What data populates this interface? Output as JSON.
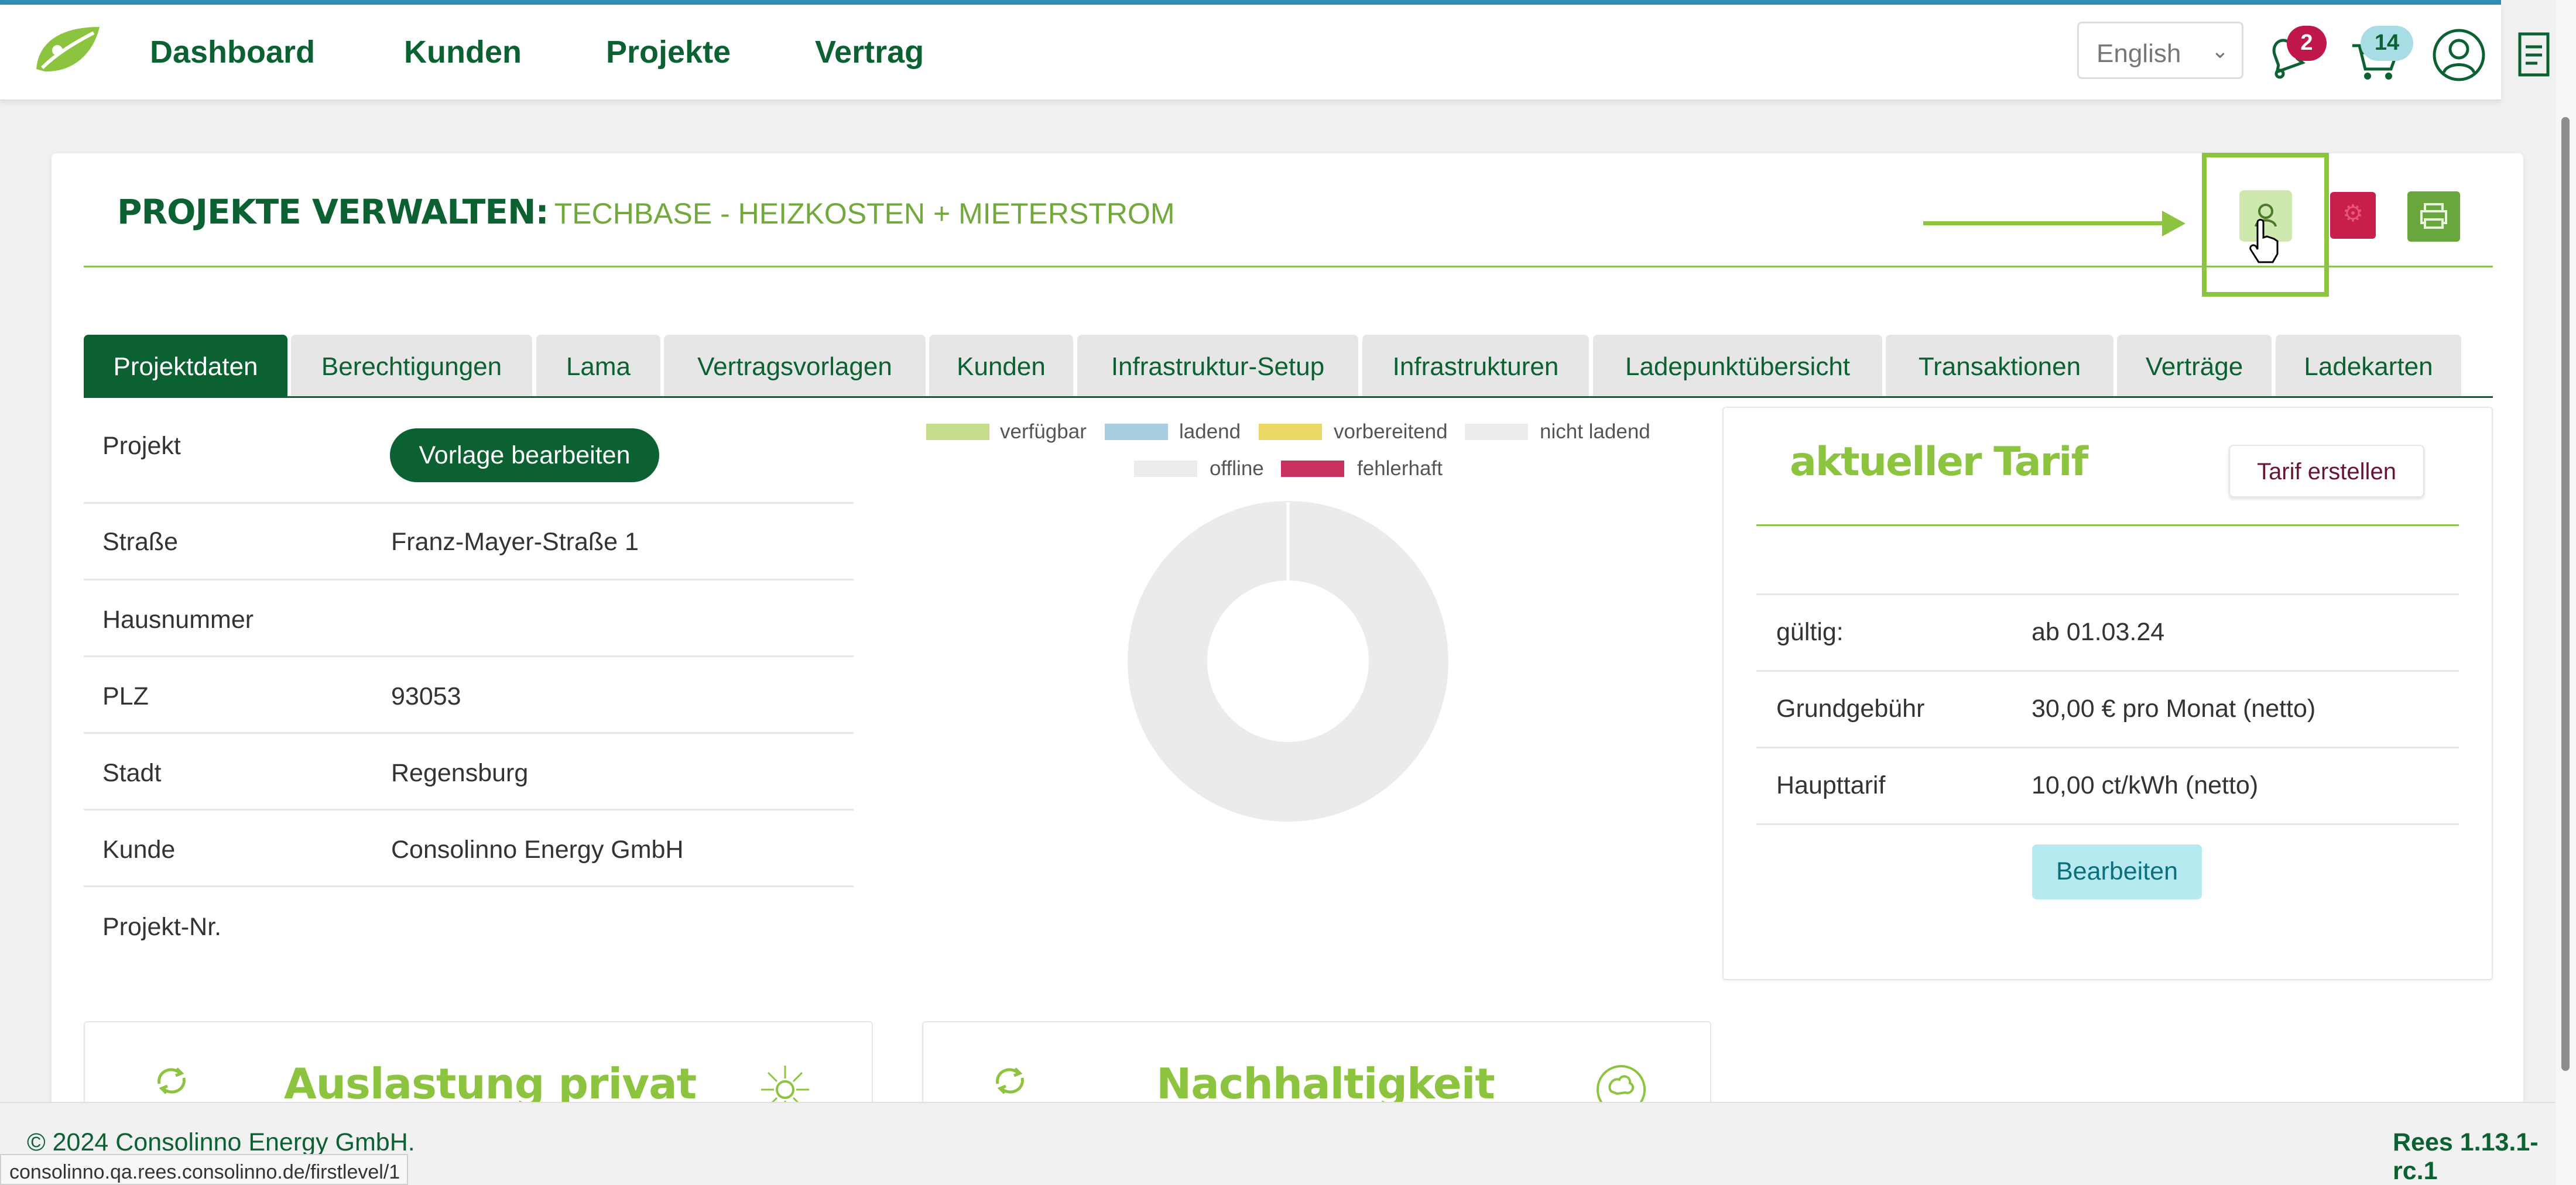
{
  "nav": {
    "links": [
      "Dashboard",
      "Kunden",
      "Projekte",
      "Vertrag"
    ],
    "language": "English",
    "notifications_count": "2",
    "messages_count": "14"
  },
  "page": {
    "title_bold": "PROJEKTE VERWALTEN:",
    "title_sub": "TECHBASE - HEIZKOSTEN + MIETERSTROM"
  },
  "tabs": [
    "Projektdaten",
    "Berechtigungen",
    "Lama",
    "Vertragsvorlagen",
    "Kunden",
    "Infrastruktur-Setup",
    "Infrastrukturen",
    "Ladepunktübersicht",
    "Transaktionen",
    "Verträge",
    "Ladekarten"
  ],
  "project": {
    "edit_template_label": "Vorlage bearbeiten",
    "rows": [
      {
        "label": "Projekt",
        "value": ""
      },
      {
        "label": "Straße",
        "value": "Franz-Mayer-Straße 1"
      },
      {
        "label": "Hausnummer",
        "value": ""
      },
      {
        "label": "PLZ",
        "value": "93053"
      },
      {
        "label": "Stadt",
        "value": "Regensburg"
      },
      {
        "label": "Kunde",
        "value": "Consolinno Energy GmbH"
      },
      {
        "label": "Projekt-Nr.",
        "value": ""
      }
    ]
  },
  "chart_data": {
    "type": "pie",
    "categories": [
      "verfügbar",
      "ladend",
      "vorbereitend",
      "nicht ladend",
      "offline",
      "fehlerhaft"
    ],
    "values": [
      0,
      0,
      0,
      0,
      0,
      0
    ],
    "colors": [
      "#c5dc8a",
      "#a9cde0",
      "#ecd865",
      "#ececec",
      "#ececec",
      "#c9325f"
    ],
    "legend": "top",
    "donut": true
  },
  "tariff": {
    "title": "aktueller Tarif",
    "create_label": "Tarif erstellen",
    "rows": [
      {
        "label": "gültig:",
        "value": "ab 01.03.24"
      },
      {
        "label": "Grundgebühr",
        "value": "30,00 € pro Monat (netto)"
      },
      {
        "label": "Haupttarif",
        "value": "10,00 ct/kWh (netto)"
      }
    ],
    "edit_label": "Bearbeiten"
  },
  "widgets": [
    "Auslastung privat",
    "Nachhaltigkeit"
  ],
  "footer": {
    "copyright": "© 2024 Consolinno Energy GmbH.",
    "version": "Rees 1.13.1-rc.1"
  },
  "status_url": "consolinno.qa.rees.consolinno.de/firstlevel/1"
}
